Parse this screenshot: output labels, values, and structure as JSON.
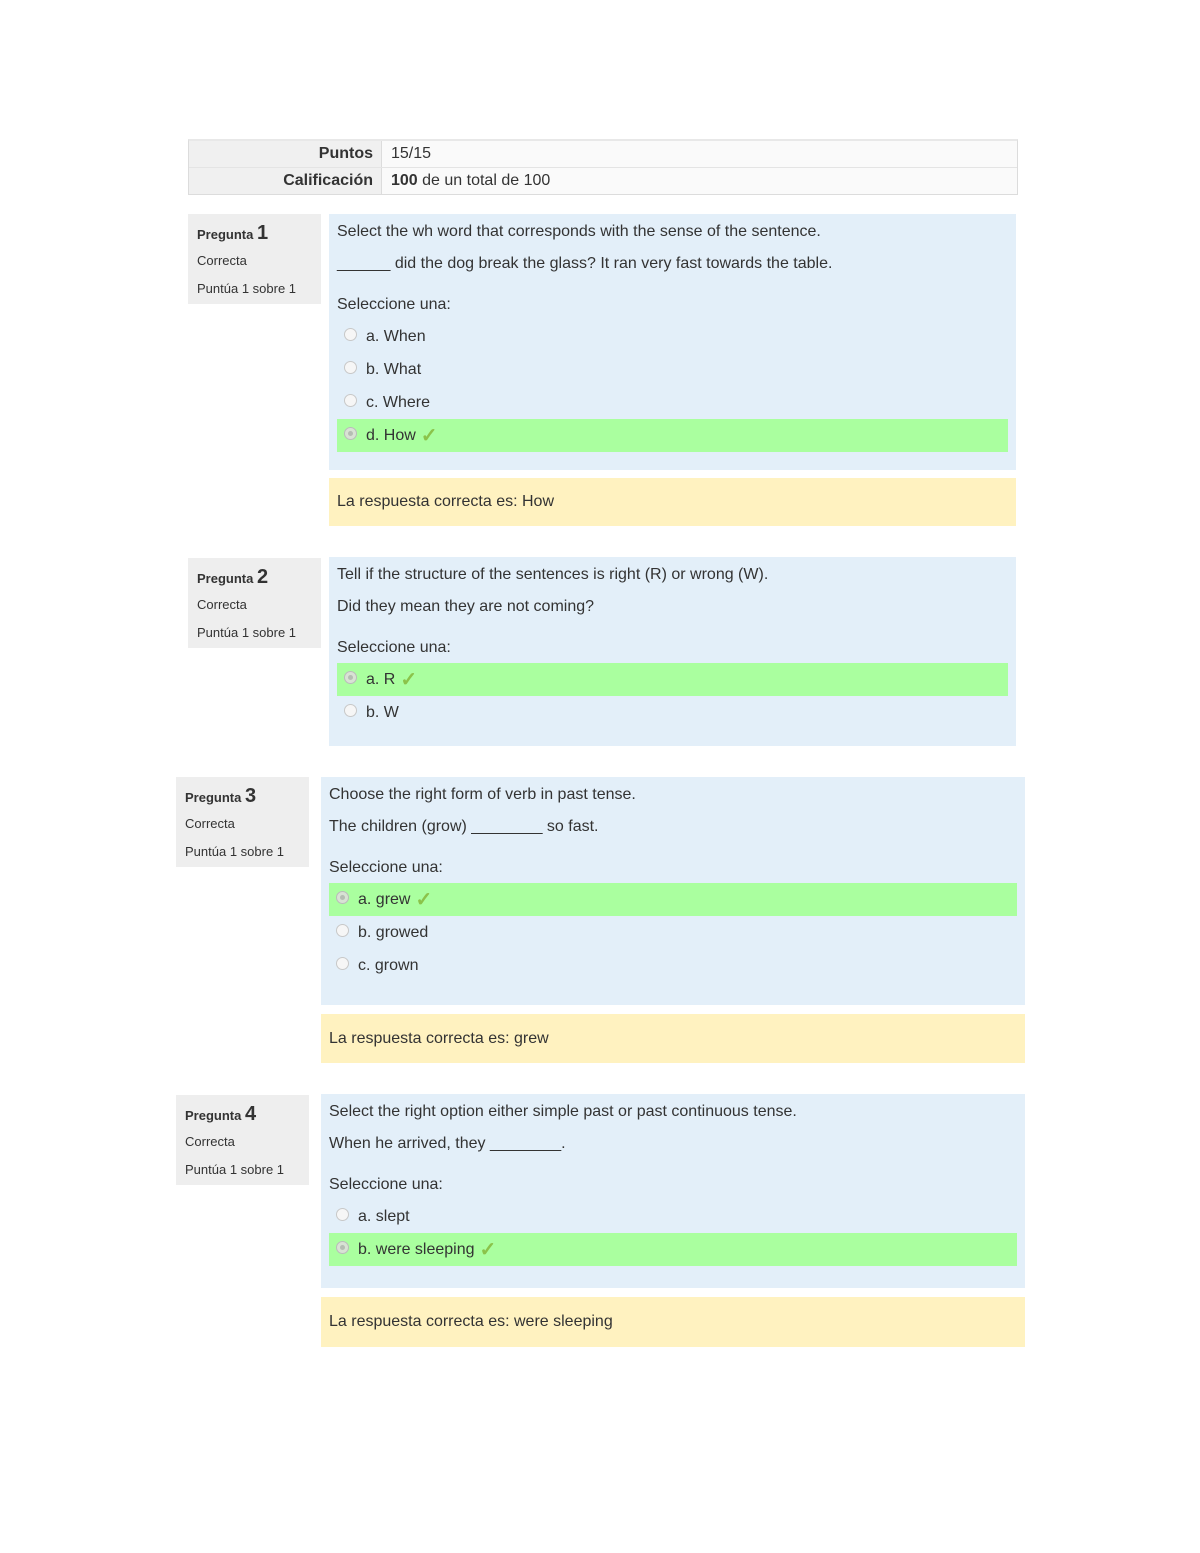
{
  "summary": {
    "rows": [
      {
        "label": "Puntos",
        "value": "15/15"
      },
      {
        "label": "Calificación",
        "value_bold": "100",
        "value_rest": " de un total de 100"
      }
    ]
  },
  "questions": [
    {
      "label": "Pregunta",
      "number": "1",
      "state": "Correcta",
      "grade": "Puntúa 1 sobre 1",
      "text": [
        "Select the wh word that corresponds with the sense of the sentence.",
        "______ did the dog break the glass? It ran very fast towards the table."
      ],
      "prompt": "Seleccione una:",
      "options": [
        {
          "label": "a. When",
          "selected": false,
          "correct": false
        },
        {
          "label": "b. What",
          "selected": false,
          "correct": false
        },
        {
          "label": "c. Where",
          "selected": false,
          "correct": false
        },
        {
          "label": "d. How",
          "selected": true,
          "correct": true
        }
      ],
      "feedback": "La respuesta correcta es: How"
    },
    {
      "label": "Pregunta",
      "number": "2",
      "state": "Correcta",
      "grade": "Puntúa 1 sobre 1",
      "text": [
        "Tell if the structure of the sentences is right (R) or wrong (W).",
        "Did they mean they are not coming?"
      ],
      "prompt": "Seleccione una:",
      "options": [
        {
          "label": "a. R",
          "selected": true,
          "correct": true
        },
        {
          "label": "b. W",
          "selected": false,
          "correct": false
        }
      ],
      "feedback": null
    },
    {
      "label": "Pregunta",
      "number": "3",
      "state": "Correcta",
      "grade": "Puntúa 1 sobre 1",
      "text": [
        "Choose the right form of verb in past tense.",
        "The children (grow) ________ so fast."
      ],
      "prompt": "Seleccione una:",
      "options": [
        {
          "label": "a. grew",
          "selected": true,
          "correct": true
        },
        {
          "label": "b. growed",
          "selected": false,
          "correct": false
        },
        {
          "label": "c. grown",
          "selected": false,
          "correct": false
        }
      ],
      "feedback": "La respuesta correcta es: grew"
    },
    {
      "label": "Pregunta",
      "number": "4",
      "state": "Correcta",
      "grade": "Puntúa 1 sobre 1",
      "text": [
        "Select the right option either simple past or past continuous tense.",
        "When he arrived, they ________."
      ],
      "prompt": "Seleccione una:",
      "options": [
        {
          "label": "a. slept",
          "selected": false,
          "correct": false
        },
        {
          "label": "b. were sleeping",
          "selected": true,
          "correct": true
        }
      ],
      "feedback": "La respuesta correcta es: were sleeping"
    }
  ],
  "icons": {
    "check": "✓"
  },
  "colors": {
    "correct_bg": "#aaff9f",
    "question_bg": "#e3eff9",
    "feedback_bg": "#fff2c0",
    "info_bg": "#eeeeee",
    "check": "#8bc34a"
  }
}
